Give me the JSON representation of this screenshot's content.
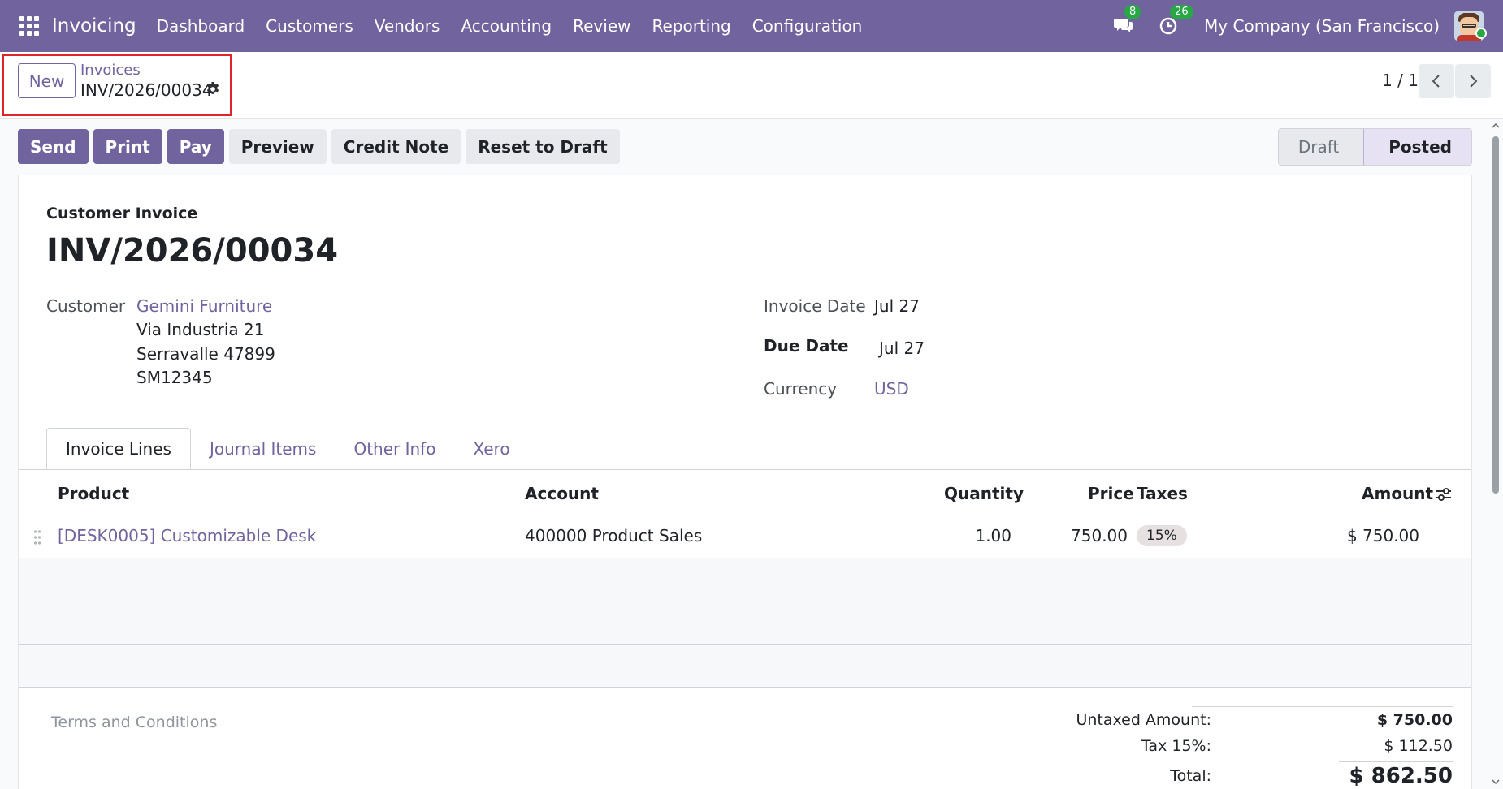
{
  "navbar": {
    "app_name": "Invoicing",
    "menu": [
      "Dashboard",
      "Customers",
      "Vendors",
      "Accounting",
      "Review",
      "Reporting",
      "Configuration"
    ],
    "messages_count": "8",
    "activities_count": "26",
    "company": "My Company (San Francisco)",
    "bg_color": "#71639e"
  },
  "control": {
    "new_label": "New",
    "breadcrumb_parent": "Invoices",
    "breadcrumb_current": "INV/2026/00034",
    "pager": "1 / 1"
  },
  "actions": {
    "send": "Send",
    "print": "Print",
    "pay": "Pay",
    "preview": "Preview",
    "credit_note": "Credit Note",
    "reset_to_draft": "Reset to Draft"
  },
  "status": {
    "draft": "Draft",
    "posted": "Posted",
    "current": "Posted"
  },
  "invoice": {
    "type": "Customer Invoice",
    "name": "INV/2026/00034",
    "customer_label": "Customer",
    "customer_name": "Gemini Furniture",
    "address_line1": "Via Industria 21",
    "address_line2": "Serravalle 47899",
    "address_line3": "SM12345",
    "invoice_date_label": "Invoice Date",
    "invoice_date": "Jul 27",
    "due_date_label": "Due Date",
    "due_date": "Jul 27",
    "currency_label": "Currency",
    "currency": "USD"
  },
  "tabs": [
    "Invoice Lines",
    "Journal Items",
    "Other Info",
    "Xero"
  ],
  "lines": {
    "headers": {
      "product": "Product",
      "account": "Account",
      "quantity": "Quantity",
      "price": "Price",
      "taxes": "Taxes",
      "amount": "Amount"
    },
    "rows": [
      {
        "product": "[DESK0005] Customizable Desk",
        "account": "400000 Product Sales",
        "quantity": "1.00",
        "price": "750.00",
        "tax": "15%",
        "amount": "$ 750.00"
      }
    ]
  },
  "footer": {
    "terms_placeholder": "Terms and Conditions",
    "untaxed_label": "Untaxed Amount:",
    "untaxed_value": "$ 750.00",
    "tax_label": "Tax 15%:",
    "tax_value": "$ 112.50",
    "total_label": "Total:",
    "total_value": "$ 862.50"
  }
}
